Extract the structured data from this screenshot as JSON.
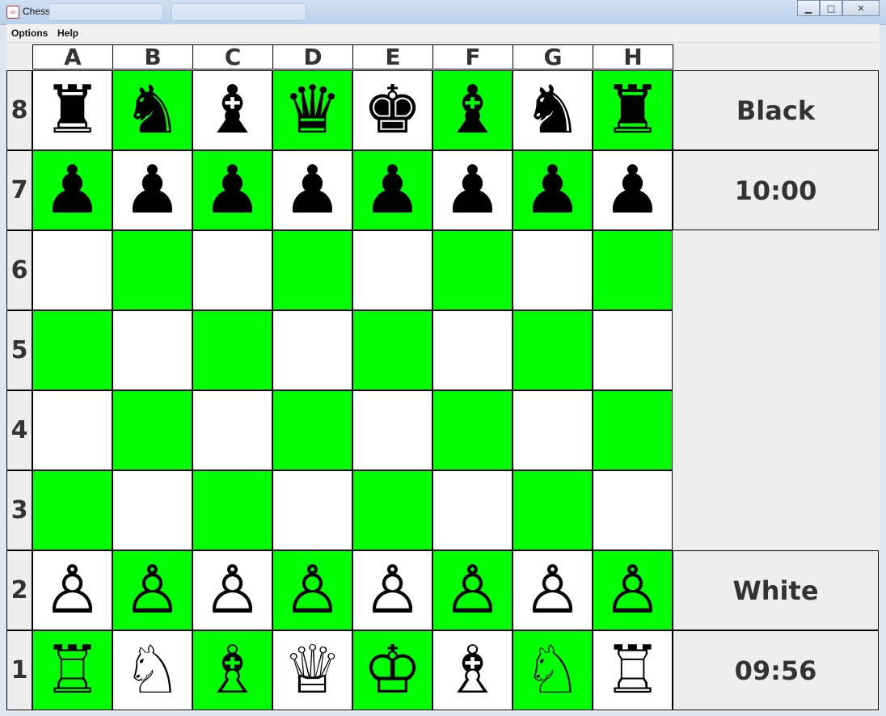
{
  "window": {
    "title": "Chess"
  },
  "menu": {
    "options": "Options",
    "help": "Help"
  },
  "columns": [
    "A",
    "B",
    "C",
    "D",
    "E",
    "F",
    "G",
    "H"
  ],
  "rows": [
    "8",
    "7",
    "6",
    "5",
    "4",
    "3",
    "2",
    "1"
  ],
  "board": [
    [
      "♜",
      "♞",
      "♝",
      "♛",
      "♚",
      "♝",
      "♞",
      "♜"
    ],
    [
      "♟",
      "♟",
      "♟",
      "♟",
      "♟",
      "♟",
      "♟",
      "♟"
    ],
    [
      "",
      "",
      "",
      "",
      "",
      "",
      "",
      ""
    ],
    [
      "",
      "",
      "",
      "",
      "",
      "",
      "",
      ""
    ],
    [
      "",
      "",
      "",
      "",
      "",
      "",
      "",
      ""
    ],
    [
      "",
      "",
      "",
      "",
      "",
      "",
      "",
      ""
    ],
    [
      "♙",
      "♙",
      "♙",
      "♙",
      "♙",
      "♙",
      "♙",
      "♙"
    ],
    [
      "♖",
      "♘",
      "♗",
      "♕",
      "♔",
      "♗",
      "♘",
      "♖"
    ]
  ],
  "pieces": {
    "♜": "black-rook",
    "♞": "black-knight",
    "♝": "black-bishop",
    "♛": "black-queen",
    "♚": "black-king",
    "♟": "black-pawn",
    "♖": "white-rook",
    "♘": "white-knight",
    "♗": "white-bishop",
    "♕": "white-queen",
    "♔": "white-king",
    "♙": "white-pawn"
  },
  "colors": {
    "light": "#ffffff",
    "dark": "#00ff00"
  },
  "side": {
    "black_label": "Black",
    "black_time": "10:00",
    "white_label": "White",
    "white_time": "09:56"
  }
}
